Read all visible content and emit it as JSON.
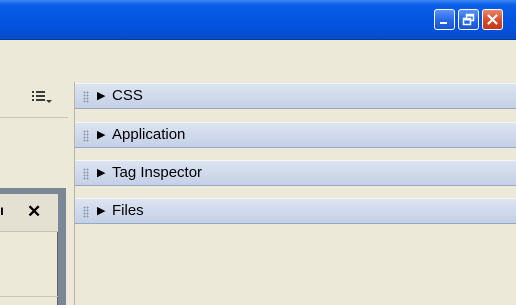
{
  "window": {
    "controls": [
      {
        "name": "minimize-icon"
      },
      {
        "name": "restore-icon"
      },
      {
        "name": "close-icon"
      }
    ]
  },
  "left_panel": {
    "options_icon": "list-options-icon",
    "tab_label_fragment": "ı",
    "close_label": "✕"
  },
  "panels": [
    {
      "label": "CSS",
      "arrow": "▶"
    },
    {
      "label": "Application",
      "arrow": "▶"
    },
    {
      "label": "Tag Inspector",
      "arrow": "▶"
    },
    {
      "label": "Files",
      "arrow": "▶"
    }
  ],
  "colors": {
    "titlebar": "#0355e0",
    "panel_header": "#c4d0e6",
    "background": "#ECE9D8",
    "close_button": "#d6492a"
  }
}
